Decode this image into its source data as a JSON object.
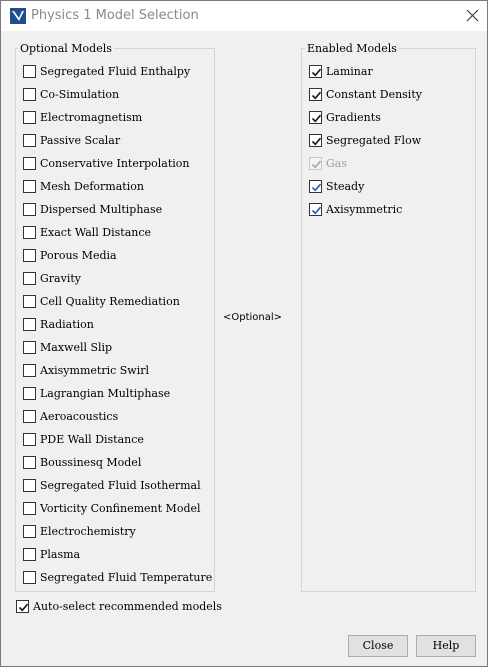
{
  "window": {
    "title": "Physics 1 Model Selection"
  },
  "optional_models": {
    "title": "Optional Models",
    "items": [
      "Segregated Fluid Enthalpy",
      "Co-Simulation",
      "Electromagnetism",
      "Passive Scalar",
      "Conservative Interpolation",
      "Mesh Deformation",
      "Dispersed Multiphase",
      "Exact Wall Distance",
      "Porous Media",
      "Gravity",
      "Cell Quality Remediation",
      "Radiation",
      "Maxwell Slip",
      "Axisymmetric Swirl",
      "Lagrangian Multiphase",
      "Aeroacoustics",
      "PDE Wall Distance",
      "Boussinesq Model",
      "Segregated Fluid Isothermal",
      "Vorticity Confinement Model",
      "Electrochemistry",
      "Plasma",
      "Segregated Fluid Temperature"
    ]
  },
  "enabled_models": {
    "title": "Enabled Models",
    "items": [
      {
        "label": "Laminar",
        "checked": true,
        "disabled": false,
        "check_style": "dark"
      },
      {
        "label": "Constant Density",
        "checked": true,
        "disabled": false,
        "check_style": "dark"
      },
      {
        "label": "Gradients",
        "checked": true,
        "disabled": false,
        "check_style": "dark"
      },
      {
        "label": "Segregated Flow",
        "checked": true,
        "disabled": false,
        "check_style": "dark"
      },
      {
        "label": "Gas",
        "checked": true,
        "disabled": true,
        "check_style": "gray"
      },
      {
        "label": "Steady",
        "checked": true,
        "disabled": false,
        "check_style": "blue"
      },
      {
        "label": "Axisymmetric",
        "checked": true,
        "disabled": false,
        "check_style": "blue"
      }
    ]
  },
  "center_label": "<Optional>",
  "auto_select": {
    "label": "Auto-select recommended models",
    "checked": true
  },
  "buttons": {
    "close": "Close",
    "help": "Help"
  },
  "colors": {
    "check_dark": "#1a1a1a",
    "check_blue": "#1f5fb8",
    "check_gray": "#a8a8a8",
    "app_icon_blue": "#1f4e8c"
  }
}
